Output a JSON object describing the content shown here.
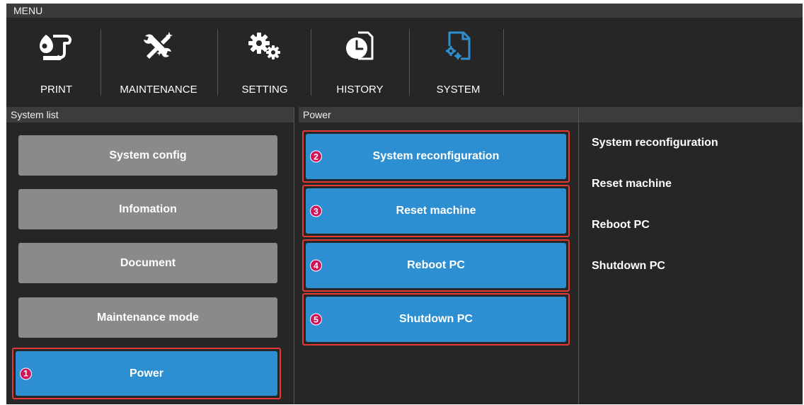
{
  "menu": {
    "label": "MENU"
  },
  "toolbar": {
    "items": [
      {
        "label": "PRINT",
        "icon": "print-icon"
      },
      {
        "label": "MAINTENANCE",
        "icon": "maintenance-icon"
      },
      {
        "label": "SETTING",
        "icon": "gears-icon"
      },
      {
        "label": "HISTORY",
        "icon": "history-icon"
      },
      {
        "label": "SYSTEM",
        "icon": "system-icon",
        "active": true
      }
    ]
  },
  "system_list": {
    "header": "System list",
    "items": [
      {
        "label": "System config"
      },
      {
        "label": "Infomation"
      },
      {
        "label": "Document"
      },
      {
        "label": "Maintenance mode"
      },
      {
        "label": "Power",
        "marker": "1",
        "selected": true
      }
    ]
  },
  "power": {
    "header": "Power",
    "items": [
      {
        "label": "System reconfiguration",
        "marker": "2"
      },
      {
        "label": "Reset machine",
        "marker": "3"
      },
      {
        "label": "Reboot PC",
        "marker": "4"
      },
      {
        "label": "Shutdown PC",
        "marker": "5"
      }
    ]
  },
  "details": {
    "header": "",
    "lines": [
      "System reconfiguration",
      "Reset machine",
      "Reboot PC",
      "Shutdown PC"
    ]
  },
  "colors": {
    "background": "#262626",
    "button_gray": "#8a8a8a",
    "button_blue": "#2d8fd1",
    "highlight": "#e53935",
    "marker": "#d4145a"
  }
}
